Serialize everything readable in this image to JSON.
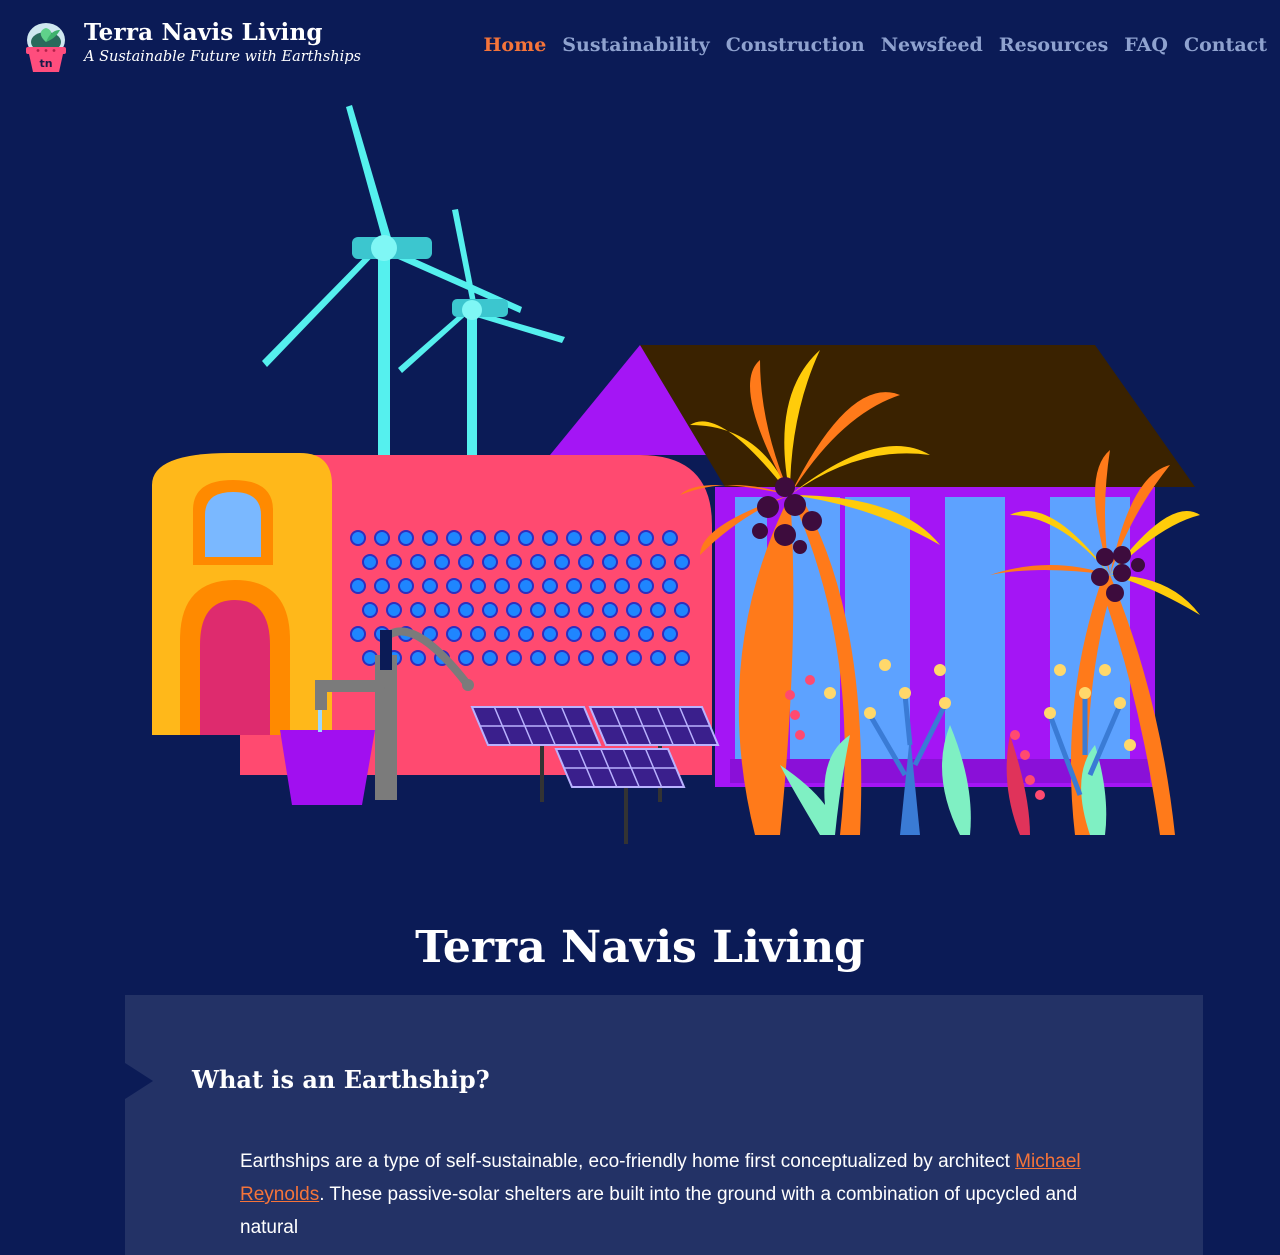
{
  "site": {
    "title": "Terra Navis Living",
    "tagline": "A Sustainable Future with Earthships",
    "logo_text": "tn"
  },
  "nav": {
    "items": [
      {
        "label": "Home",
        "active": true
      },
      {
        "label": "Sustainability",
        "active": false
      },
      {
        "label": "Construction",
        "active": false
      },
      {
        "label": "Newsfeed",
        "active": false
      },
      {
        "label": "Resources",
        "active": false
      },
      {
        "label": "FAQ",
        "active": false
      },
      {
        "label": "Contact",
        "active": false
      }
    ]
  },
  "main": {
    "page_title": "Terra Navis Living",
    "section": {
      "heading": "What is an Earthship?",
      "body_before_link": "Earthships are a type of self-sustainable, eco-friendly home first conceptualized by architect ",
      "link_text": "Michael Reynolds",
      "body_after_link": ". These passive-solar shelters are built into the ground with a combination of upcycled and natural"
    }
  },
  "colors": {
    "background": "#0b1b56",
    "accent": "#f5743a",
    "nav_text": "#8fa2cf",
    "card": "#233266"
  },
  "icons": {
    "logo": "planter-pot-icon",
    "hero": "earthship-illustration"
  }
}
